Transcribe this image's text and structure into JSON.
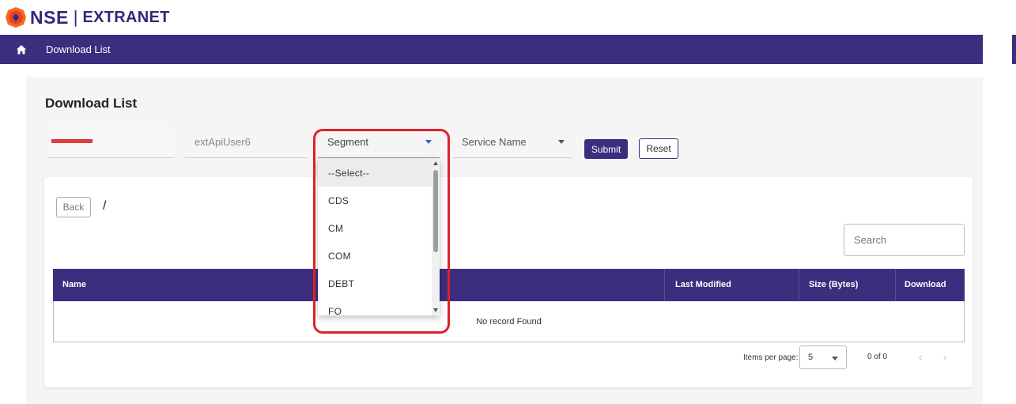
{
  "header": {
    "brand": "NSE",
    "separator": "|",
    "product": "EXTRANET"
  },
  "navbar": {
    "home_icon": "home-icon",
    "title": "Download List"
  },
  "page": {
    "title": "Download List"
  },
  "filters": {
    "member_code": "",
    "user_id": "extApiUser6",
    "segment": {
      "placeholder": "Segment",
      "options": [
        "--Select--",
        "CDS",
        "CM",
        "COM",
        "DEBT",
        "FO"
      ],
      "highlighted": "--Select--"
    },
    "service": {
      "placeholder": "Service Name"
    },
    "submit_label": "Submit",
    "reset_label": "Reset"
  },
  "browser": {
    "back_label": "Back",
    "path": "/",
    "search_placeholder": "Search"
  },
  "table": {
    "columns": [
      "Name",
      "Last Modified",
      "Size (Bytes)",
      "Download"
    ],
    "empty_message": "No record Found"
  },
  "pagination": {
    "items_per_page_label": "Items per page:",
    "items_per_page_value": "5",
    "range": "0 of 0",
    "prev_icon": "chevron-left-icon",
    "next_icon": "chevron-right-icon"
  },
  "colors": {
    "brand_purple": "#3b2e7e",
    "highlight_red": "#e0202a",
    "logo_orange": "#f26b21"
  }
}
